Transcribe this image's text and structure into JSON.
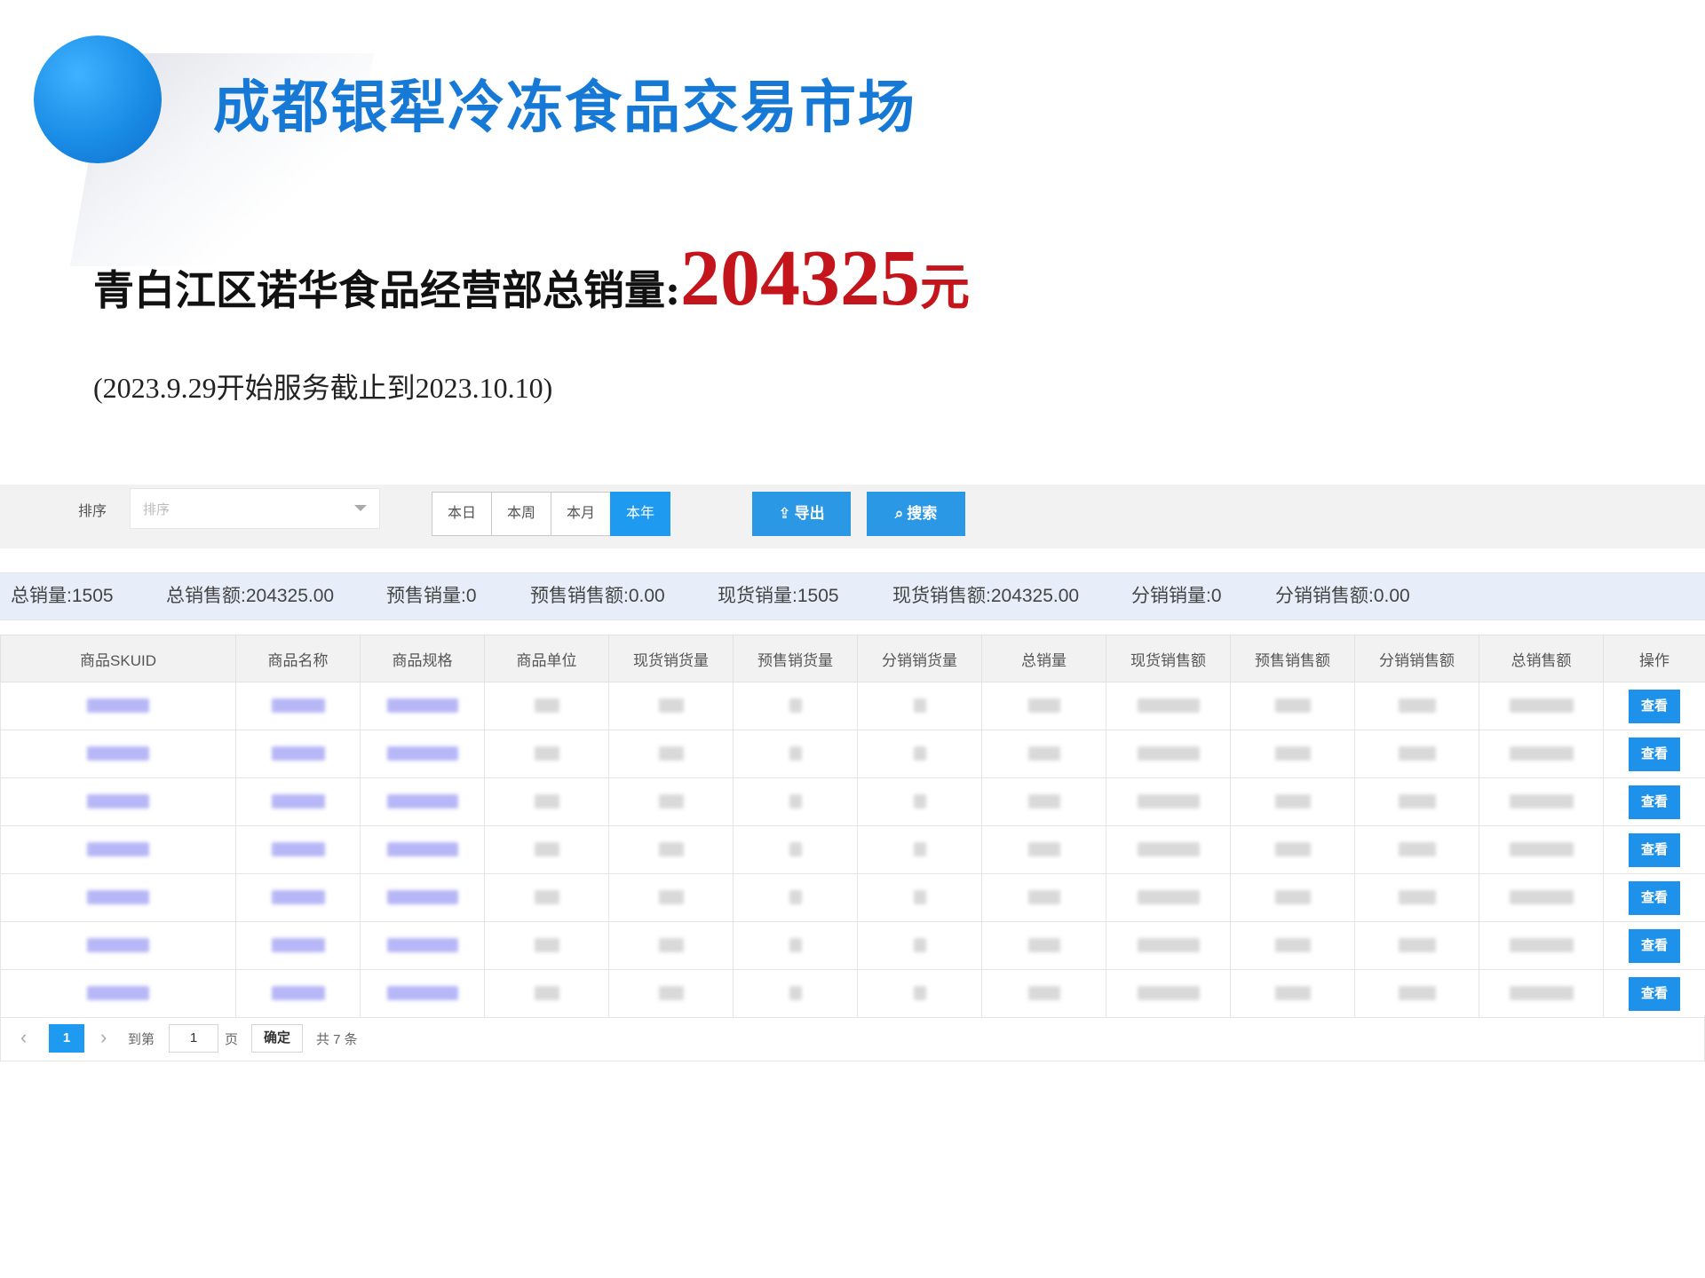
{
  "header": {
    "market_title": "成都银犁冷冻食品交易市场"
  },
  "summary": {
    "label": "青白江区诺华食品经营部总销量:",
    "value": "204325",
    "unit": "元",
    "period": "(2023.9.29开始服务截止到2023.10.10)"
  },
  "filters": {
    "sort_label": "排序",
    "sort_placeholder": "排序",
    "periods": [
      "本日",
      "本周",
      "本月",
      "本年"
    ],
    "active_period": "本年",
    "export_label": "导出",
    "search_label": "搜索"
  },
  "stats": [
    "总销量:1505",
    "总销售额:204325.00",
    "预售销量:0",
    "预售销售额:0.00",
    "现货销量:1505",
    "现货销售额:204325.00",
    "分销销量:0",
    "分销销售额:0.00"
  ],
  "table": {
    "columns": [
      "商品SKUID",
      "商品名称",
      "商品规格",
      "商品单位",
      "现货销货量",
      "预售销货量",
      "分销销货量",
      "总销量",
      "现货销售额",
      "预售销售额",
      "分销销售额",
      "总销售额",
      "操作"
    ],
    "row_action_label": "查看",
    "row_count": 7
  },
  "pagination": {
    "current_page": "1",
    "goto_label": "到第",
    "input_value": "1",
    "page_unit": "页",
    "confirm_label": "确定",
    "total_text": "共 7 条"
  }
}
